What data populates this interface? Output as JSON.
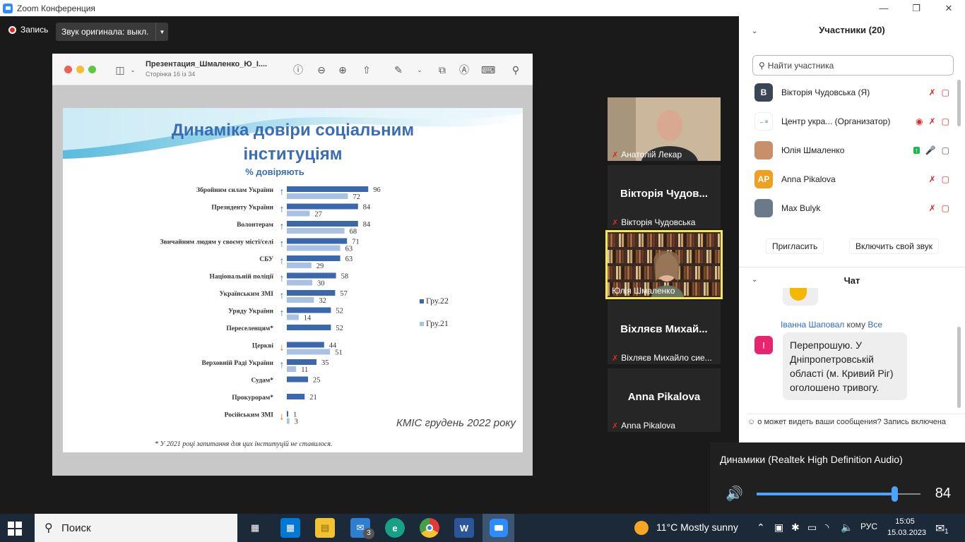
{
  "window": {
    "title": "Zoom Конференция"
  },
  "recording": {
    "label": "Запись"
  },
  "audio_original": {
    "label": "Звук оригинала: выкл."
  },
  "viewer": {
    "title": "Презентация_Шмаленко_Ю_І....",
    "page_info": "Сторінка 16 із 34"
  },
  "slide": {
    "title_line1": "Динаміка довіри соціальним",
    "title_line2": "інституціям",
    "subtitle": "% довіряють",
    "source": "КМІС грудень 2022 року",
    "footnote": "* У 2021 році запитання для цих інституцій не ставилося."
  },
  "chart_data": {
    "type": "bar",
    "orientation": "horizontal",
    "categories": [
      "Збройним силам України",
      "Президенту України",
      "Волонтерам",
      "Звичайним людям у своєму місті/селі",
      "СБУ",
      "Національній поліції",
      "Українським ЗМІ",
      "Уряду України",
      "Переселенцям*",
      "Церкві",
      "Верховній Раді України",
      "Судам*",
      "Прокурорам*",
      "Російським ЗМІ"
    ],
    "series": [
      {
        "name": "Гру.22",
        "color": "#3b67ad",
        "values": [
          96,
          84,
          84,
          71,
          63,
          58,
          57,
          52,
          52,
          44,
          35,
          25,
          21,
          1
        ]
      },
      {
        "name": "Гру.21",
        "color": "#a9c1e3",
        "values": [
          72,
          27,
          68,
          63,
          29,
          30,
          32,
          14,
          null,
          51,
          11,
          null,
          null,
          3
        ]
      }
    ],
    "trend": [
      "up",
      "up",
      "up",
      "up",
      "up",
      "up",
      "up",
      "up",
      "",
      "down",
      "up",
      "",
      "",
      "down"
    ],
    "trend_colors": {
      "up": "#3b67ad",
      "down": "#c0642a"
    },
    "xlim": [
      0,
      100
    ],
    "legend_position": "right"
  },
  "thumbnails": [
    {
      "name": "Анатолій Лекар",
      "muted": true,
      "video": true
    },
    {
      "name": "Вікторія Чудовська",
      "display": "Вікторія Чудов...",
      "muted": true
    },
    {
      "name": "Юлія Шмаленко",
      "active": true,
      "video": true
    },
    {
      "name": "Віхляєв Михайло сие...",
      "display": "Віхляєв Михай...",
      "muted": true
    },
    {
      "name": "Anna Pikalova",
      "display": "Anna Pikalova",
      "muted": true
    }
  ],
  "participants": {
    "header": "Участники (20)",
    "search_placeholder": "Найти участника",
    "items": [
      {
        "name": "Вікторія Чудовська (Я)",
        "initial": "В",
        "color": "#3a4555"
      },
      {
        "name": "Центр укра... (Организатор)",
        "initial": "",
        "color": "#ffffff"
      },
      {
        "name": "Юлія Шмаленко",
        "initial": "",
        "color": "#c98f6a"
      },
      {
        "name": "Anna Pikalova",
        "initial": "AP",
        "color": "#f0a020"
      },
      {
        "name": "Max Bulyk",
        "initial": "",
        "color": "#6b7a8a"
      }
    ],
    "invite_label": "Пригласить",
    "unmute_label": "Включить свой звук"
  },
  "chat": {
    "header": "Чат",
    "sender": "Іванна Шаповал",
    "to_word": "кому",
    "recipient": "Все",
    "avatar_initial": "I",
    "message": "Перепрошую. У Дніпропетровській області (м. Кривий Ріг) оголошено тривогу.",
    "notice": "о может видеть ваши сообщения? Запись включена"
  },
  "volume_flyout": {
    "device": "Динамики (Realtek High Definition Audio)",
    "level": 84
  },
  "taskbar": {
    "search_placeholder": "Поиск",
    "mail_badge": "3",
    "weather": "11°C  Mostly sunny",
    "language": "РУС",
    "time": "15:05",
    "date": "15.03.2023",
    "notifications": "1"
  }
}
